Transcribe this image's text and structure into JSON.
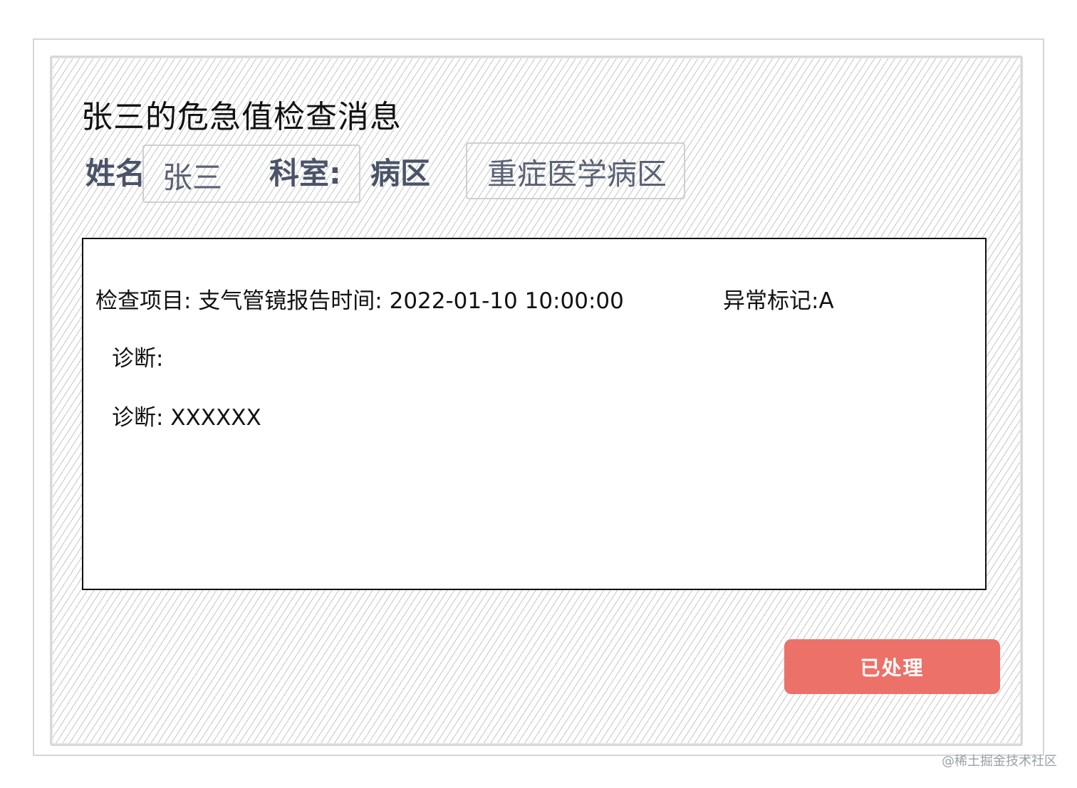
{
  "title": "张三的危急值检查消息",
  "patient": {
    "name_label": "姓名",
    "name_value": "张三",
    "dept_label": "科室:",
    "ward_label": "病区",
    "ward_value": "重症医学病区"
  },
  "detail": {
    "exam_line": "检查项目: 支气管镜报告时间: 2022-01-10 10:00:00",
    "abnormal_flag": "异常标记:A",
    "diagnosis_1": "诊断:",
    "diagnosis_2": "诊断:  XXXXXX"
  },
  "actions": {
    "processed_label": "已处理"
  },
  "watermark": "@稀土掘金技术社区",
  "colors": {
    "button": "#ec7168",
    "label": "#4a5367",
    "text": "#111111"
  }
}
